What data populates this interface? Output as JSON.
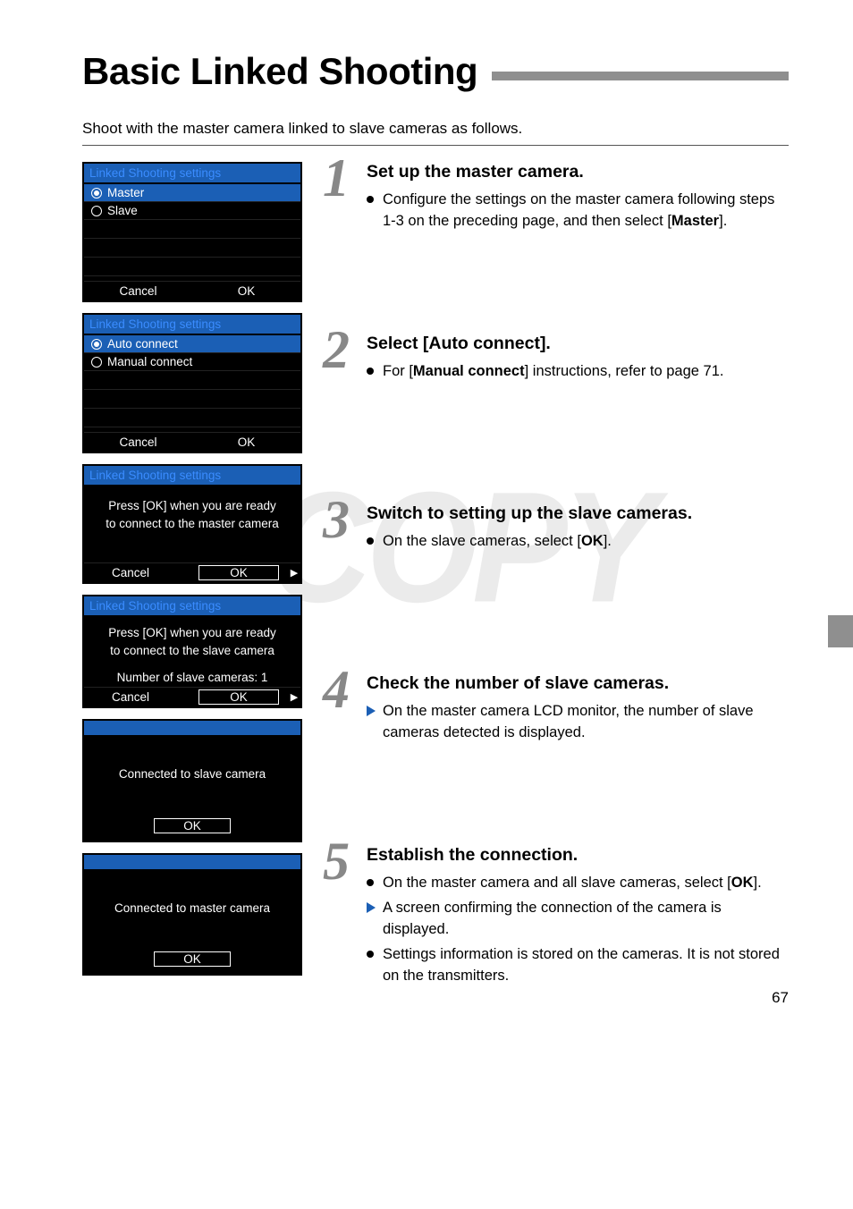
{
  "page": {
    "title": "Basic Linked Shooting",
    "intro": "Shoot with the master camera linked to slave cameras as follows.",
    "number": "67",
    "watermark": "COPY"
  },
  "screens": {
    "s1": {
      "header": "Linked Shooting settings",
      "opt1": "Master",
      "opt2": "Slave",
      "cancel": "Cancel",
      "ok": "OK"
    },
    "s2": {
      "header": "Linked Shooting settings",
      "opt1": "Auto connect",
      "opt2": "Manual connect",
      "cancel": "Cancel",
      "ok": "OK"
    },
    "s3": {
      "header": "Linked Shooting settings",
      "line1": "Press [OK] when you are ready",
      "line2": "to connect to the master camera",
      "cancel": "Cancel",
      "ok": "OK"
    },
    "s4": {
      "header": "Linked Shooting settings",
      "line1": "Press [OK] when you are ready",
      "line2": "to connect to the slave camera",
      "line3": "Number of slave cameras: 1",
      "cancel": "Cancel",
      "ok": "OK"
    },
    "s5": {
      "msg": "Connected to slave camera",
      "ok": "OK"
    },
    "s6": {
      "msg": "Connected to master camera",
      "ok": "OK"
    }
  },
  "steps": {
    "st1": {
      "num": "1",
      "heading": "Set up the master camera.",
      "b1a": "Configure the settings on the master camera following steps 1-3 on the preceding page, and then select [",
      "b1b": "Master",
      "b1c": "]."
    },
    "st2": {
      "num": "2",
      "heading": "Select [Auto connect].",
      "b1a": "For [",
      "b1b": "Manual connect",
      "b1c": "] instructions, refer to page 71."
    },
    "st3": {
      "num": "3",
      "heading": "Switch to setting up the slave cameras.",
      "b1a": "On the slave cameras, select [",
      "b1b": "OK",
      "b1c": "]."
    },
    "st4": {
      "num": "4",
      "heading": "Check the number of slave cameras.",
      "b1": "On the master camera LCD monitor, the number of slave cameras detected is displayed."
    },
    "st5": {
      "num": "5",
      "heading": "Establish the connection.",
      "b1a": "On the master camera and all slave cameras, select [",
      "b1b": "OK",
      "b1c": "].",
      "b2": "A screen confirming the connection of the camera is displayed.",
      "b3": "Settings information is stored on the cameras. It is not stored on the transmitters."
    }
  }
}
